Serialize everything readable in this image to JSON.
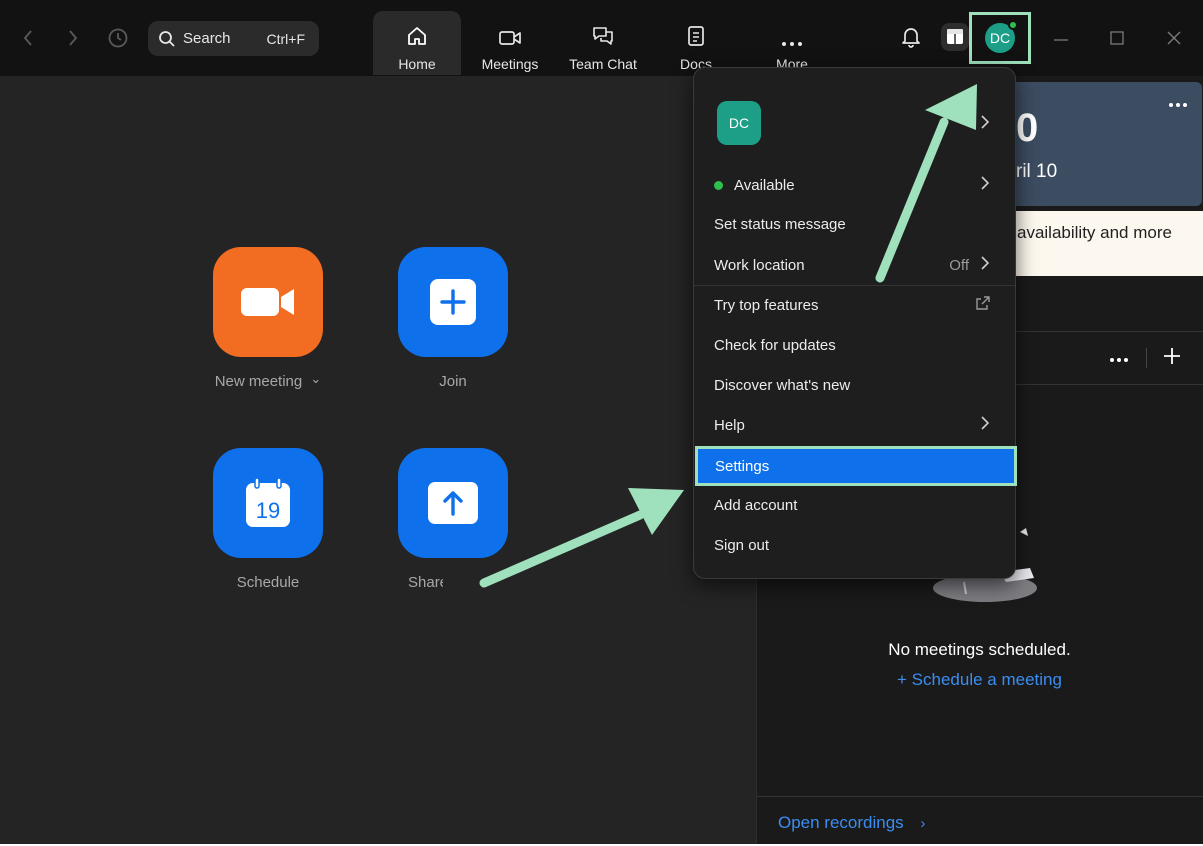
{
  "topbar": {
    "search": {
      "label": "Search",
      "shortcut": "Ctrl+F"
    },
    "tabs": [
      {
        "label": "Home",
        "icon": "home-icon"
      },
      {
        "label": "Meetings",
        "icon": "video-icon"
      },
      {
        "label": "Team Chat",
        "icon": "chat-icon"
      },
      {
        "label": "Docs",
        "icon": "doc-icon"
      },
      {
        "label": "More",
        "icon": "more-dots-icon"
      }
    ],
    "avatar_initials": "DC"
  },
  "home": {
    "tiles": [
      {
        "label": "New meeting",
        "icon": "video-camera-icon",
        "color": "#f26d21"
      },
      {
        "label": "Join",
        "icon": "plus-icon",
        "color": "#0e71eb"
      },
      {
        "label": "Schedule",
        "icon": "calendar-icon",
        "calendar_day": "19",
        "color": "#0e71eb"
      },
      {
        "label": "Share screen",
        "icon": "share-up-arrow-icon",
        "color": "#0e71eb"
      }
    ],
    "new_meeting_chevron": "⌄"
  },
  "right_panel": {
    "date_big": "0",
    "date_small": "ril 10",
    "banner_text": "availability and more",
    "empty_text": "No meetings scheduled.",
    "schedule_link": "+ Schedule a meeting",
    "open_recordings": "Open recordings",
    "chevron": "›"
  },
  "menu": {
    "avatar_initials": "DC",
    "items": [
      {
        "label": "Available",
        "status_color": "#2fbf4f"
      },
      {
        "label": "Set status message"
      },
      {
        "label": "Work location",
        "value": "Off"
      },
      {
        "label": "Try top features"
      },
      {
        "label": "Check for updates"
      },
      {
        "label": "Discover what's new"
      },
      {
        "label": "Help"
      },
      {
        "label": "Settings",
        "selected": true
      },
      {
        "label": "Add account"
      },
      {
        "label": "Sign out"
      }
    ]
  },
  "colors": {
    "accent_blue": "#0e71eb",
    "highlight_green": "#9fe1bd",
    "brand_orange": "#f26d21"
  }
}
